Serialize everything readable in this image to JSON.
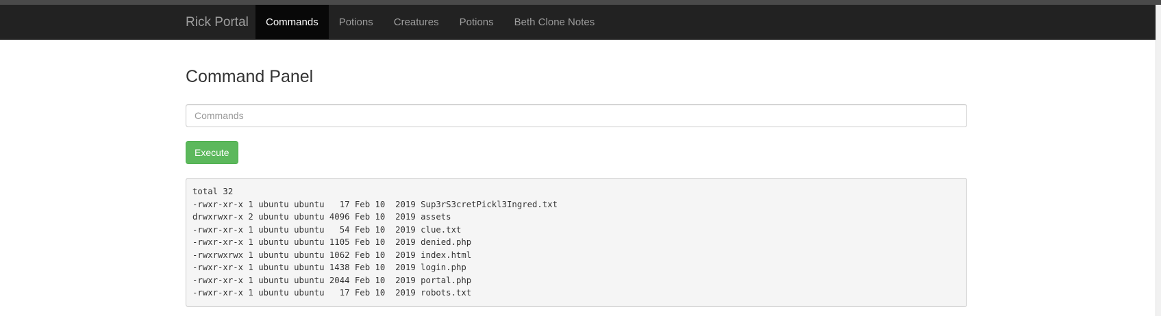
{
  "navbar": {
    "brand": "Rick Portal",
    "items": [
      {
        "label": "Commands",
        "active": true
      },
      {
        "label": "Potions",
        "active": false
      },
      {
        "label": "Creatures",
        "active": false
      },
      {
        "label": "Potions",
        "active": false
      },
      {
        "label": "Beth Clone Notes",
        "active": false
      }
    ]
  },
  "main": {
    "title": "Command Panel",
    "command_input": {
      "value": "",
      "placeholder": "Commands"
    },
    "execute_label": "Execute",
    "output_lines": [
      "total 32",
      "-rwxr-xr-x 1 ubuntu ubuntu   17 Feb 10  2019 Sup3rS3cretPickl3Ingred.txt",
      "drwxrwxr-x 2 ubuntu ubuntu 4096 Feb 10  2019 assets",
      "-rwxr-xr-x 1 ubuntu ubuntu   54 Feb 10  2019 clue.txt",
      "-rwxr-xr-x 1 ubuntu ubuntu 1105 Feb 10  2019 denied.php",
      "-rwxrwxrwx 1 ubuntu ubuntu 1062 Feb 10  2019 index.html",
      "-rwxr-xr-x 1 ubuntu ubuntu 1438 Feb 10  2019 login.php",
      "-rwxr-xr-x 1 ubuntu ubuntu 2044 Feb 10  2019 portal.php",
      "-rwxr-xr-x 1 ubuntu ubuntu   17 Feb 10  2019 robots.txt"
    ]
  },
  "colors": {
    "navbar_bg": "#222222",
    "nav_active_bg": "#080808",
    "execute_bg": "#5cb85c",
    "output_bg": "#f5f5f5"
  }
}
